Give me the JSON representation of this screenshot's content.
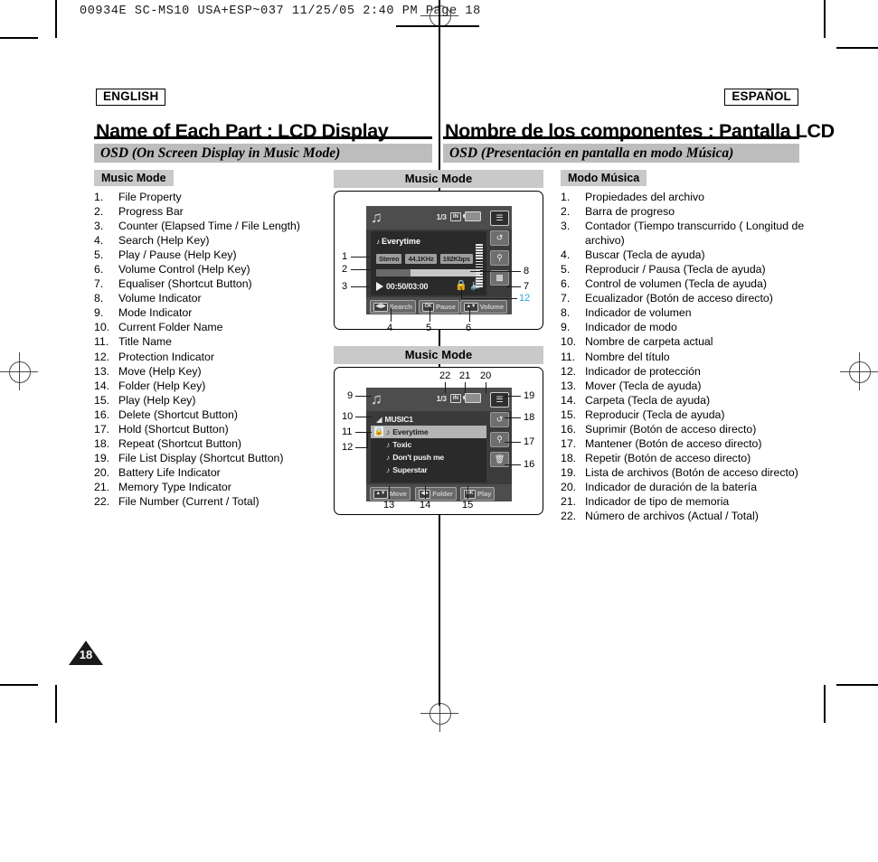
{
  "print": {
    "slug": "00934E SC-MS10  USA+ESP~037   11/25/05 2:40 PM   Page  18",
    "page_number": "18"
  },
  "header": {
    "lang_en": "ENGLISH",
    "lang_es": "ESPAÑOL",
    "title_en": "Name of Each Part : LCD Display",
    "title_es": "Nombre de los componentes : Pantalla LCD",
    "subtitle_en": "OSD (On Screen Display in Music Mode)",
    "subtitle_es": "OSD (Presentación en pantalla en modo Música)"
  },
  "english": {
    "mode_heading": "Music Mode",
    "items": [
      {
        "num": "1.",
        "text": "File Property"
      },
      {
        "num": "2.",
        "text": "Progress Bar"
      },
      {
        "num": "3.",
        "text": "Counter (Elapsed Time / File Length)"
      },
      {
        "num": "4.",
        "text": "Search (Help Key)"
      },
      {
        "num": "5.",
        "text": "Play / Pause (Help Key)"
      },
      {
        "num": "6.",
        "text": "Volume Control (Help Key)"
      },
      {
        "num": "7.",
        "text": "Equaliser (Shortcut Button)"
      },
      {
        "num": "8.",
        "text": "Volume Indicator"
      },
      {
        "num": "9.",
        "text": "Mode Indicator"
      },
      {
        "num": "10.",
        "text": "Current Folder Name"
      },
      {
        "num": "11.",
        "text": "Title Name"
      },
      {
        "num": "12.",
        "text": "Protection Indicator"
      },
      {
        "num": "13.",
        "text": "Move (Help Key)"
      },
      {
        "num": "14.",
        "text": "Folder (Help Key)"
      },
      {
        "num": "15.",
        "text": "Play (Help Key)"
      },
      {
        "num": "16.",
        "text": "Delete (Shortcut Button)"
      },
      {
        "num": "17.",
        "text": "Hold (Shortcut Button)"
      },
      {
        "num": "18.",
        "text": "Repeat (Shortcut Button)"
      },
      {
        "num": "19.",
        "text": "File List Display (Shortcut Button)"
      },
      {
        "num": "20.",
        "text": "Battery Life Indicator"
      },
      {
        "num": "21.",
        "text": "Memory Type Indicator"
      },
      {
        "num": "22.",
        "text": "File Number (Current / Total)"
      }
    ]
  },
  "spanish": {
    "mode_heading": "Modo Música",
    "items": [
      {
        "num": "1.",
        "text": "Propiedades del archivo"
      },
      {
        "num": "2.",
        "text": "Barra de progreso"
      },
      {
        "num": "3.",
        "text": "Contador (Tiempo transcurrido ( Longitud de archivo)"
      },
      {
        "num": "4.",
        "text": "Buscar (Tecla de ayuda)"
      },
      {
        "num": "5.",
        "text": "Reproducir / Pausa (Tecla de ayuda)"
      },
      {
        "num": "6.",
        "text": "Control de volumen (Tecla de ayuda)"
      },
      {
        "num": "7.",
        "text": "Ecualizador (Botón de acceso directo)"
      },
      {
        "num": "8.",
        "text": "Indicador de volumen"
      },
      {
        "num": "9.",
        "text": "Indicador de modo"
      },
      {
        "num": "10.",
        "text": "Nombre de carpeta actual"
      },
      {
        "num": "11.",
        "text": "Nombre del título"
      },
      {
        "num": "12.",
        "text": "Indicador de protección"
      },
      {
        "num": "13.",
        "text": "Mover (Tecla de ayuda)"
      },
      {
        "num": "14.",
        "text": "Carpeta (Tecla de ayuda)"
      },
      {
        "num": "15.",
        "text": "Reproducir (Tecla de ayuda)"
      },
      {
        "num": "16.",
        "text": "Suprimir (Botón de acceso directo)"
      },
      {
        "num": "17.",
        "text": "Mantener (Botón de acceso directo)"
      },
      {
        "num": "18.",
        "text": "Repetir (Botón de acceso directo)"
      },
      {
        "num": "19.",
        "text": "Lista de archivos (Botón de acceso directo)"
      },
      {
        "num": "20.",
        "text": "Indicador de duración de la batería"
      },
      {
        "num": "21.",
        "text": "Indicador de tipo de memoria"
      },
      {
        "num": "22.",
        "text": "Número de archivos (Actual / Total)"
      }
    ]
  },
  "lcd_play": {
    "panel_title": "Music Mode",
    "file_number": "1/3",
    "memory_type": "IN",
    "track_title": "Everytime",
    "tags": [
      "Stereo",
      "44.1KHz",
      "192Kbps"
    ],
    "counter": "00:50/03:00",
    "progress_percent": 33,
    "help_keys": [
      {
        "key": "◀▮▶",
        "label": "Search"
      },
      {
        "key": "OK",
        "label": "Pause"
      },
      {
        "key": "▲▼",
        "label": "Volume"
      }
    ],
    "rail_icons": [
      "file-list-icon",
      "repeat-icon",
      "hold-icon",
      "equaliser-icon"
    ],
    "callouts": [
      {
        "n": "1"
      },
      {
        "n": "2"
      },
      {
        "n": "3"
      },
      {
        "n": "4"
      },
      {
        "n": "5"
      },
      {
        "n": "6"
      },
      {
        "n": "7"
      },
      {
        "n": "8"
      },
      {
        "n": "12"
      }
    ]
  },
  "lcd_list": {
    "panel_title": "Music Mode",
    "file_number": "1/3",
    "memory_type": "IN",
    "folder_name": "MUSIC1",
    "files": [
      {
        "name": "Everytime",
        "selected": true,
        "protected": true
      },
      {
        "name": "Toxic",
        "selected": false,
        "protected": false
      },
      {
        "name": "Don't push me",
        "selected": false,
        "protected": false
      },
      {
        "name": "Superstar",
        "selected": false,
        "protected": false
      }
    ],
    "help_keys": [
      {
        "key": "▲▼",
        "label": "Move"
      },
      {
        "key": "◀▶",
        "label": "Folder"
      },
      {
        "key": "OK",
        "label": "Play"
      }
    ],
    "rail_icons": [
      "file-list-icon",
      "repeat-icon",
      "hold-icon",
      "delete-icon"
    ],
    "callouts": [
      {
        "n": "9"
      },
      {
        "n": "10"
      },
      {
        "n": "11"
      },
      {
        "n": "12"
      },
      {
        "n": "13"
      },
      {
        "n": "14"
      },
      {
        "n": "15"
      },
      {
        "n": "16"
      },
      {
        "n": "17"
      },
      {
        "n": "18"
      },
      {
        "n": "19"
      },
      {
        "n": "20"
      },
      {
        "n": "21"
      },
      {
        "n": "22"
      }
    ]
  },
  "colors": {
    "accent_blue": "#29a6dd",
    "bar_gray": "#bdbdbd",
    "lcd_dark": "#2a2a2a"
  }
}
